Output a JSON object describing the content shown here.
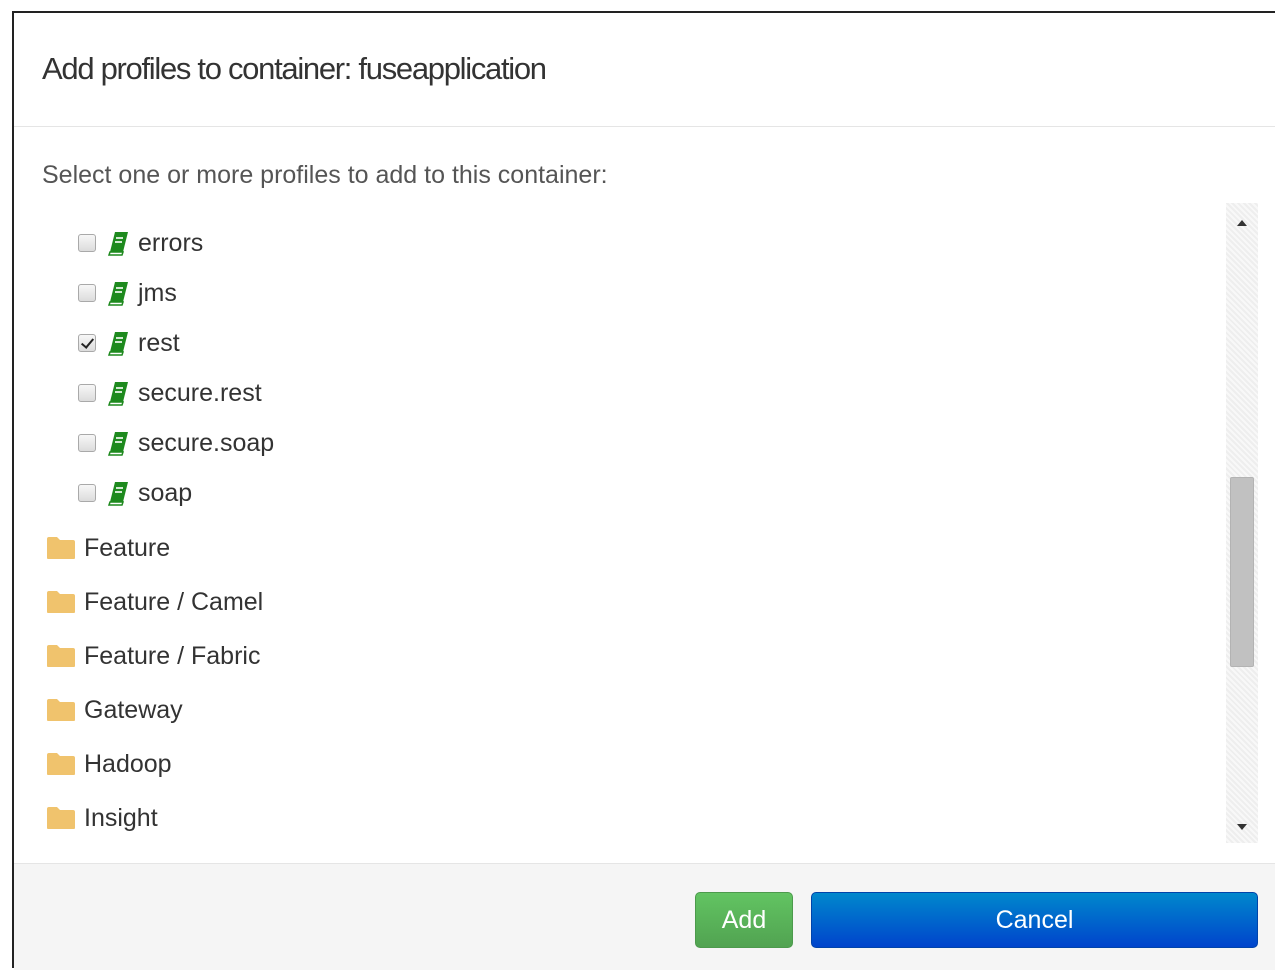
{
  "dialog": {
    "title": "Add profiles to container: fuseapplication",
    "instructions": "Select one or more profiles to add to this container:"
  },
  "profiles": [
    {
      "label": "errors",
      "checked": false,
      "icon": "book-icon"
    },
    {
      "label": "jms",
      "checked": false,
      "icon": "book-icon"
    },
    {
      "label": "rest",
      "checked": true,
      "icon": "book-icon"
    },
    {
      "label": "secure.rest",
      "checked": false,
      "icon": "book-icon"
    },
    {
      "label": "secure.soap",
      "checked": false,
      "icon": "book-icon"
    },
    {
      "label": "soap",
      "checked": false,
      "icon": "book-icon"
    }
  ],
  "folders": [
    {
      "label": "Feature",
      "icon": "folder-icon"
    },
    {
      "label": "Feature / Camel",
      "icon": "folder-icon"
    },
    {
      "label": "Feature / Fabric",
      "icon": "folder-icon"
    },
    {
      "label": "Gateway",
      "icon": "folder-icon"
    },
    {
      "label": "Hadoop",
      "icon": "folder-icon"
    },
    {
      "label": "Insight",
      "icon": "folder-icon"
    }
  ],
  "buttons": {
    "add_label": "Add",
    "cancel_label": "Cancel"
  },
  "colors": {
    "book_icon": "#1e8a1e",
    "folder_icon": "#f0c36d",
    "add_button": "#5bb75b",
    "cancel_button": "#0066cc"
  }
}
